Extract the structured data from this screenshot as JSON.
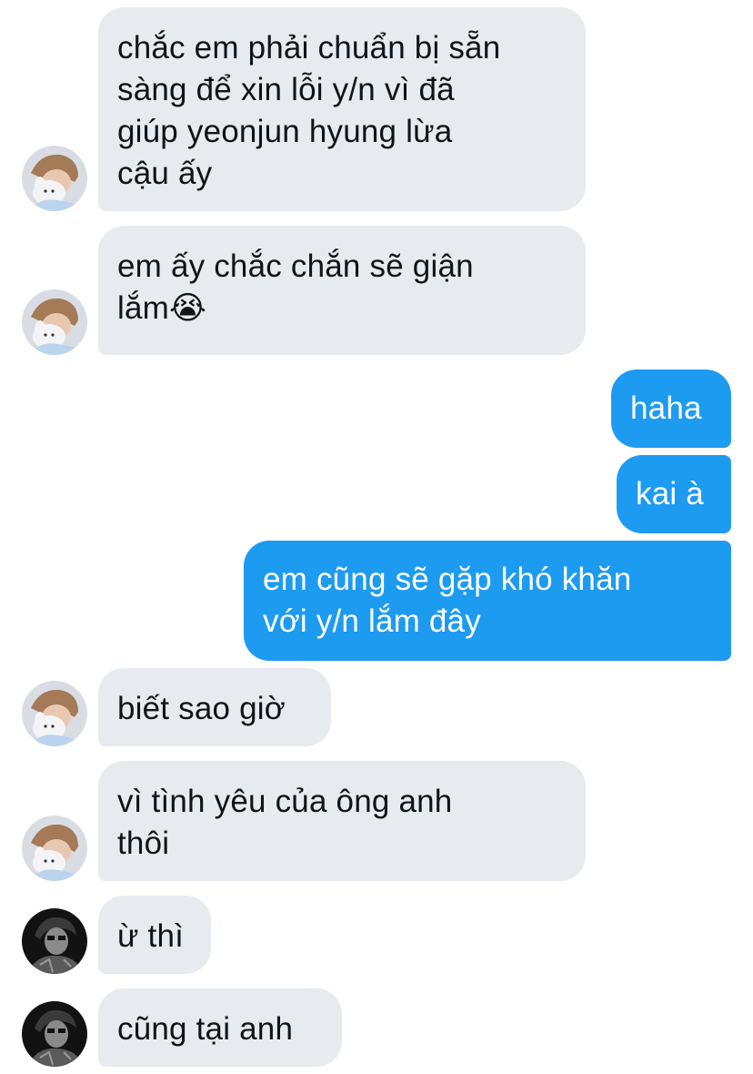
{
  "messages": [
    {
      "from": "them",
      "avatar": "boy-with-plush-avatar",
      "text": "chắc em phải chuẩn bị sẵn\nsàng để xin lỗi y/n vì đã\ngiúp yeonjun hyung lừa\ncậu ấy"
    },
    {
      "from": "them",
      "avatar": "boy-with-plush-avatar",
      "text": "em ấy chắc chắn sẽ giận\nlắm😭"
    },
    {
      "from": "me",
      "text": "haha"
    },
    {
      "from": "me",
      "text": "kai à"
    },
    {
      "from": "me",
      "text": "em cũng sẽ gặp khó khăn\nvới y/n lắm đây"
    },
    {
      "from": "them",
      "avatar": "boy-with-plush-avatar",
      "text": "biết sao giờ"
    },
    {
      "from": "them",
      "avatar": "boy-with-plush-avatar",
      "text": "vì tình yêu của ông anh\nthôi"
    },
    {
      "from": "them",
      "avatar": "dark-portrait-avatar",
      "text": "ừ thì"
    },
    {
      "from": "them",
      "avatar": "dark-portrait-avatar",
      "text": "cũng tại anh"
    }
  ],
  "colors": {
    "incoming_bubble": "#e7ebef",
    "outgoing_bubble": "#1d9bf0",
    "incoming_text": "#0f1419",
    "outgoing_text": "#ffffff"
  }
}
